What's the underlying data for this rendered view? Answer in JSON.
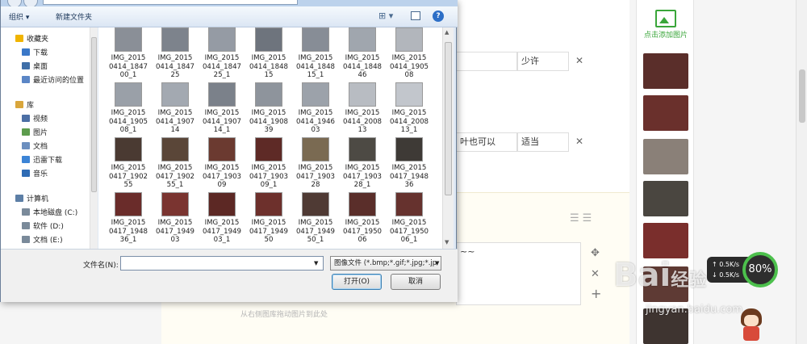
{
  "dialog": {
    "toolbar": {
      "organize": "组织 ▾",
      "new_folder": "新建文件夹",
      "view_icon": "⊞ ▾",
      "help": "?"
    },
    "nav": [
      {
        "label": "收藏夹",
        "icon": "star-icon",
        "color": "#f0b400",
        "indent": 0
      },
      {
        "label": "下载",
        "icon": "download-folder-icon",
        "color": "#3a78c8",
        "indent": 1
      },
      {
        "label": "桌面",
        "icon": "desktop-icon",
        "color": "#3f6fa8",
        "indent": 1
      },
      {
        "label": "最近访问的位置",
        "icon": "recent-places-icon",
        "color": "#5b86c6",
        "indent": 1
      },
      {
        "label": "库",
        "icon": "libraries-icon",
        "color": "#d9a63c",
        "indent": 0
      },
      {
        "label": "视频",
        "icon": "videos-icon",
        "color": "#4c6fa5",
        "indent": 1
      },
      {
        "label": "图片",
        "icon": "pictures-icon",
        "color": "#5d9c4d",
        "indent": 1
      },
      {
        "label": "文档",
        "icon": "documents-icon",
        "color": "#6c8fbf",
        "indent": 1
      },
      {
        "label": "迅雷下载",
        "icon": "thunder-download-icon",
        "color": "#3c84d6",
        "indent": 1
      },
      {
        "label": "音乐",
        "icon": "music-icon",
        "color": "#2f6cb5",
        "indent": 1
      },
      {
        "label": "计算机",
        "icon": "computer-icon",
        "color": "#5d7fa6",
        "indent": 0
      },
      {
        "label": "本地磁盘 (C:)",
        "icon": "disk-c-icon",
        "color": "#7a8a9a",
        "indent": 1
      },
      {
        "label": "软件 (D:)",
        "icon": "disk-d-icon",
        "color": "#7a8a9a",
        "indent": 1
      },
      {
        "label": "文档 (E:)",
        "icon": "disk-e-icon",
        "color": "#7a8a9a",
        "indent": 1
      }
    ],
    "files": [
      {
        "line1": "IMG_2015",
        "line2": "0414_1847",
        "line3": "00_1",
        "tone": "#8a8f97"
      },
      {
        "line1": "IMG_2015",
        "line2": "0414_1847",
        "line3": "25",
        "tone": "#7d838c"
      },
      {
        "line1": "IMG_2015",
        "line2": "0414_1847",
        "line3": "25_1",
        "tone": "#959ba4"
      },
      {
        "line1": "IMG_2015",
        "line2": "0414_1848",
        "line3": "15",
        "tone": "#6e747d"
      },
      {
        "line1": "IMG_2015",
        "line2": "0414_1848",
        "line3": "15_1",
        "tone": "#878d96"
      },
      {
        "line1": "IMG_2015",
        "line2": "0414_1848",
        "line3": "46",
        "tone": "#a0a6ae"
      },
      {
        "line1": "IMG_2015",
        "line2": "0414_1905",
        "line3": "08",
        "tone": "#b2b6bc"
      },
      {
        "line1": "IMG_2015",
        "line2": "0414_1905",
        "line3": "08_1",
        "tone": "#9aa0a8"
      },
      {
        "line1": "IMG_2015",
        "line2": "0414_1907",
        "line3": "14",
        "tone": "#a3a9b1"
      },
      {
        "line1": "IMG_2015",
        "line2": "0414_1907",
        "line3": "14_1",
        "tone": "#7b818a"
      },
      {
        "line1": "IMG_2015",
        "line2": "0414_1908",
        "line3": "39",
        "tone": "#8e949c"
      },
      {
        "line1": "IMG_2015",
        "line2": "0414_1946",
        "line3": "03",
        "tone": "#9ca2aa"
      },
      {
        "line1": "IMG_2015",
        "line2": "0414_2008",
        "line3": "13",
        "tone": "#b8bcc2"
      },
      {
        "line1": "IMG_2015",
        "line2": "0414_2008",
        "line3": "13_1",
        "tone": "#c2c6cc"
      },
      {
        "line1": "IMG_2015",
        "line2": "0417_1902",
        "line3": "55",
        "tone": "#4a3a32"
      },
      {
        "line1": "IMG_2015",
        "line2": "0417_1902",
        "line3": "55_1",
        "tone": "#5a4638"
      },
      {
        "line1": "IMG_2015",
        "line2": "0417_1903",
        "line3": "09",
        "tone": "#6b3a30"
      },
      {
        "line1": "IMG_2015",
        "line2": "0417_1903",
        "line3": "09_1",
        "tone": "#5e2a26"
      },
      {
        "line1": "IMG_2015",
        "line2": "0417_1903",
        "line3": "28",
        "tone": "#7a6a52"
      },
      {
        "line1": "IMG_2015",
        "line2": "0417_1903",
        "line3": "28_1",
        "tone": "#4d4a44"
      },
      {
        "line1": "IMG_2015",
        "line2": "0417_1948",
        "line3": "36",
        "tone": "#3e3a36"
      },
      {
        "line1": "IMG_2015",
        "line2": "0417_1948",
        "line3": "36_1",
        "tone": "#6a2c2a"
      },
      {
        "line1": "IMG_2015",
        "line2": "0417_1949",
        "line3": "03",
        "tone": "#7a3430"
      },
      {
        "line1": "IMG_2015",
        "line2": "0417_1949",
        "line3": "03_1",
        "tone": "#5c2824"
      },
      {
        "line1": "IMG_2015",
        "line2": "0417_1949",
        "line3": "50",
        "tone": "#6d302c"
      },
      {
        "line1": "IMG_2015",
        "line2": "0417_1949",
        "line3": "50_1",
        "tone": "#4f3a34"
      },
      {
        "line1": "IMG_2015",
        "line2": "0417_1950",
        "line3": "06",
        "tone": "#5a2e2a"
      },
      {
        "line1": "IMG_2015",
        "line2": "0417_1950",
        "line3": "06_1",
        "tone": "#66322e"
      }
    ],
    "filename_label": "文件名(N):",
    "filename_value": "",
    "filetype_value": "图像文件 (*.bmp;*.gif;*.jpg;*.jp",
    "open_label": "打开(O)",
    "cancel_label": "取消"
  },
  "page": {
    "ingredients": [
      {
        "name": "",
        "amount": "少许"
      },
      {
        "name": "叶也可以",
        "amount": "适当"
      }
    ],
    "remove_glyph": "✕",
    "step_text": "~~",
    "move_glyph": "✥",
    "delete_glyph": "✕",
    "add_glyph": "+",
    "list_icons": "☰☰",
    "drag_hint": "从右侧图库拖动图片到此处",
    "add_pic_label": "点击添加图片",
    "speed": {
      "up": "0.5K/s",
      "down": "0.5K/s",
      "percent": "80%"
    },
    "watermark": {
      "logo": "Bai",
      "logo_suffix": "经验",
      "url": "jingyan.baidu.com"
    }
  }
}
